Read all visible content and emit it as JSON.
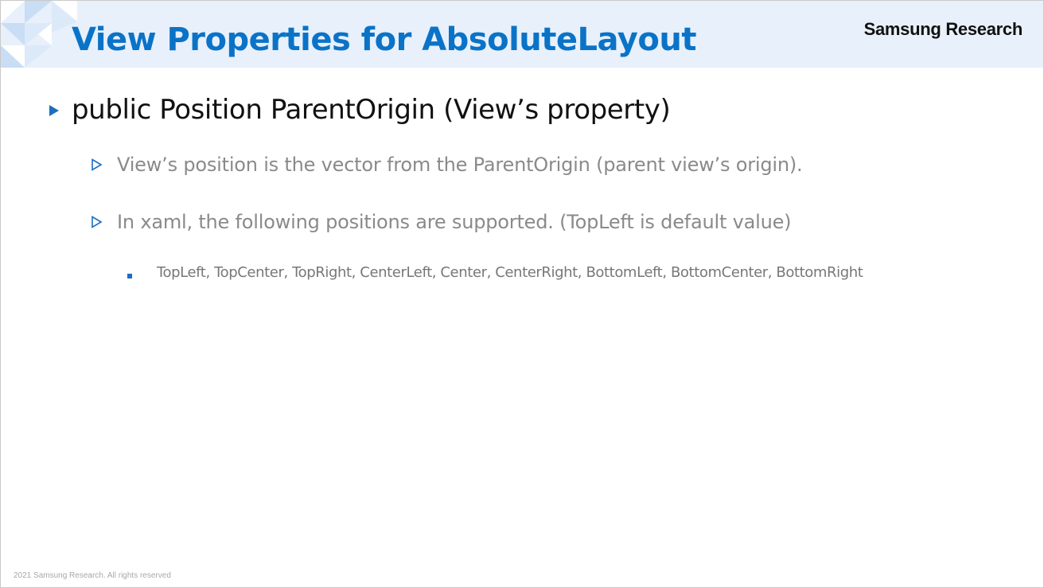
{
  "header": {
    "title": "View Properties for AbsoluteLayout",
    "brand": "Samsung Research"
  },
  "content": {
    "bullets": [
      {
        "text": "public Position ParentOrigin (View’s property)",
        "children": [
          {
            "text": "View’s position is the vector from the ParentOrigin (parent view’s origin)."
          },
          {
            "text": "In xaml, the following positions are supported. (TopLeft is default value)",
            "children": [
              {
                "text": "TopLeft, TopCenter, TopRight, CenterLeft, Center, CenterRight, BottomLeft, BottomCenter, BottomRight"
              }
            ]
          }
        ]
      }
    ]
  },
  "footer": {
    "copyright": "2021 Samsung Research. All rights reserved"
  },
  "colors": {
    "title": "#0a73c7",
    "header_band": "#e8f0fb",
    "bullet_marker": "#1a6fc0",
    "sub_text": "#8a8a8a"
  },
  "icons": {
    "level1_marker": "filled-triangle-right-icon",
    "level2_marker": "outline-triangle-right-icon",
    "level3_marker": "square-bullet-icon"
  }
}
